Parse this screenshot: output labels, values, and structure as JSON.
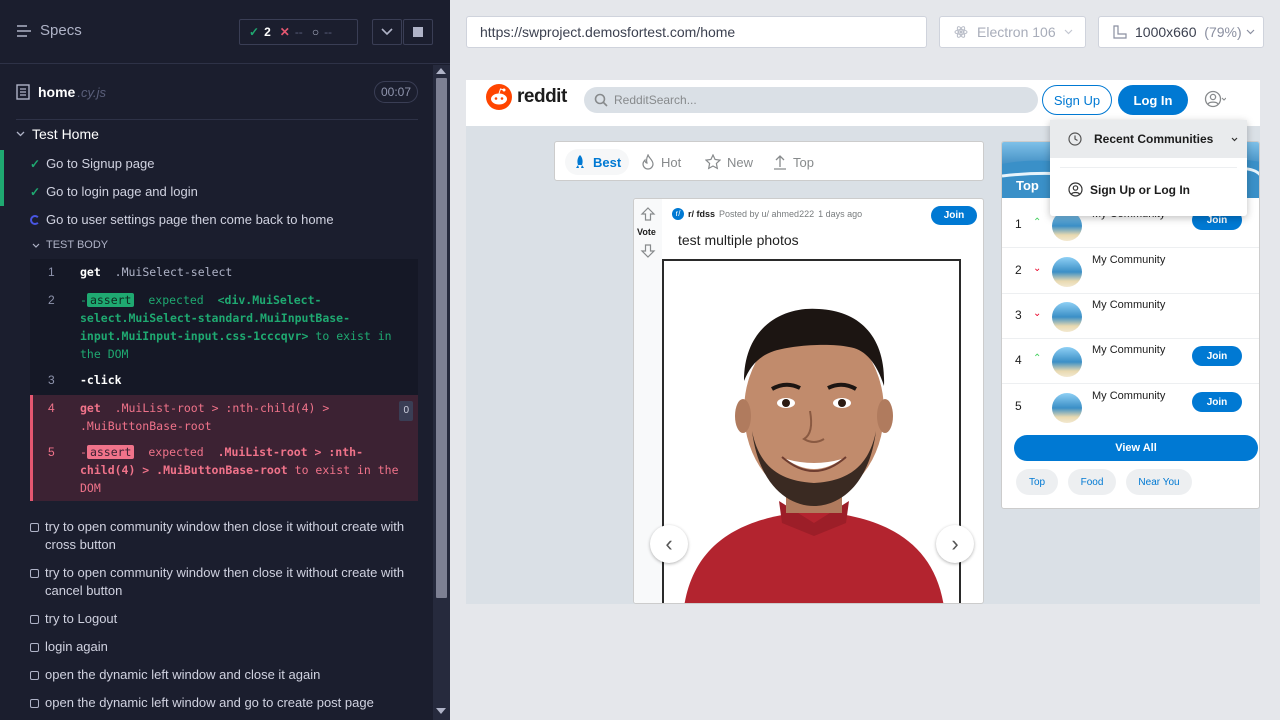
{
  "runner": {
    "specs_label": "Specs",
    "stats": {
      "passed": "2",
      "failed": "--",
      "pending": "--"
    },
    "file": {
      "name": "home",
      "ext": ".cy.js",
      "duration": "00:07"
    },
    "suite_title": "Test Home",
    "tests": [
      {
        "title": "Go to Signup page",
        "state": "passed"
      },
      {
        "title": "Go to login page and login",
        "state": "passed"
      },
      {
        "title": "Go to user settings page then come back to home",
        "state": "running"
      }
    ],
    "test_body_label": "TEST BODY",
    "commands": [
      {
        "num": "1",
        "name": "get",
        "message": ".MuiSelect-select"
      },
      {
        "num": "2",
        "name": "-assert",
        "badge": "assert",
        "expected_word": "expected",
        "message_1": "<div.MuiSelect-",
        "message_2": "select.MuiSelect-standard.MuiInputBase-",
        "message_3": "input.MuiInput-input.css-1cccqvr>",
        "tail_1": "to exist in",
        "tail_2": "the DOM"
      },
      {
        "num": "3",
        "name": "-click"
      },
      {
        "num": "4",
        "name": "get",
        "message_1": ".MuiList-root > :nth-child(4) >",
        "message_2": ".MuiButtonBase-root",
        "retry_count": "0"
      },
      {
        "num": "5",
        "badge": "assert",
        "expected_word": "expected",
        "message_1": ".MuiList-root > :nth-",
        "message_2": "child(4) > .MuiButtonBase-root",
        "tail_1": "to exist in the",
        "tail_2": "DOM"
      }
    ],
    "pending_tests": [
      "try to open community window then close it without create with cross button",
      "try to open community window then close it without create with cancel button",
      "try to Logout",
      "login again",
      "open the dynamic left window and close it again",
      "open the dynamic left window and go to create post page"
    ]
  },
  "browser": {
    "url": "https://swproject.demosfortest.com/home",
    "browser_name": "Electron 106",
    "viewport": "1000x660",
    "zoom": "(79%)"
  },
  "reddit": {
    "logo_text": "reddit",
    "search_placeholder": "RedditSearch...",
    "signup_label": "Sign Up",
    "login_label": "Log In",
    "sort_tabs": [
      "Best",
      "Hot",
      "New",
      "Top"
    ],
    "post": {
      "vote_label": "Vote",
      "subreddit": "r/ fdss",
      "posted_by": "Posted by u/ ahmed222",
      "time": "1 days ago",
      "join_label": "Join",
      "title": "test multiple photos"
    },
    "sidebar": {
      "header": "Top",
      "communities": [
        {
          "rank": "1",
          "trend": "up",
          "name": "My Community",
          "join": "Join"
        },
        {
          "rank": "2",
          "trend": "down",
          "name": "My Community",
          "join": ""
        },
        {
          "rank": "3",
          "trend": "down",
          "name": "My Community",
          "join": ""
        },
        {
          "rank": "4",
          "trend": "up",
          "name": "My Community",
          "join": "Join"
        },
        {
          "rank": "5",
          "trend": "",
          "name": "My Community",
          "join": "Join"
        }
      ],
      "view_all": "View All",
      "chips": [
        "Top",
        "Food",
        "Near You"
      ]
    },
    "dropdown": {
      "recent_communities": "Recent Communities",
      "sign_up_or_log_in": "Sign Up or Log In"
    }
  },
  "colors": {
    "pass": "#1fa971",
    "fail": "#e45770",
    "reddit_blue": "#0079d3",
    "reddit_orange": "#ff4500"
  }
}
